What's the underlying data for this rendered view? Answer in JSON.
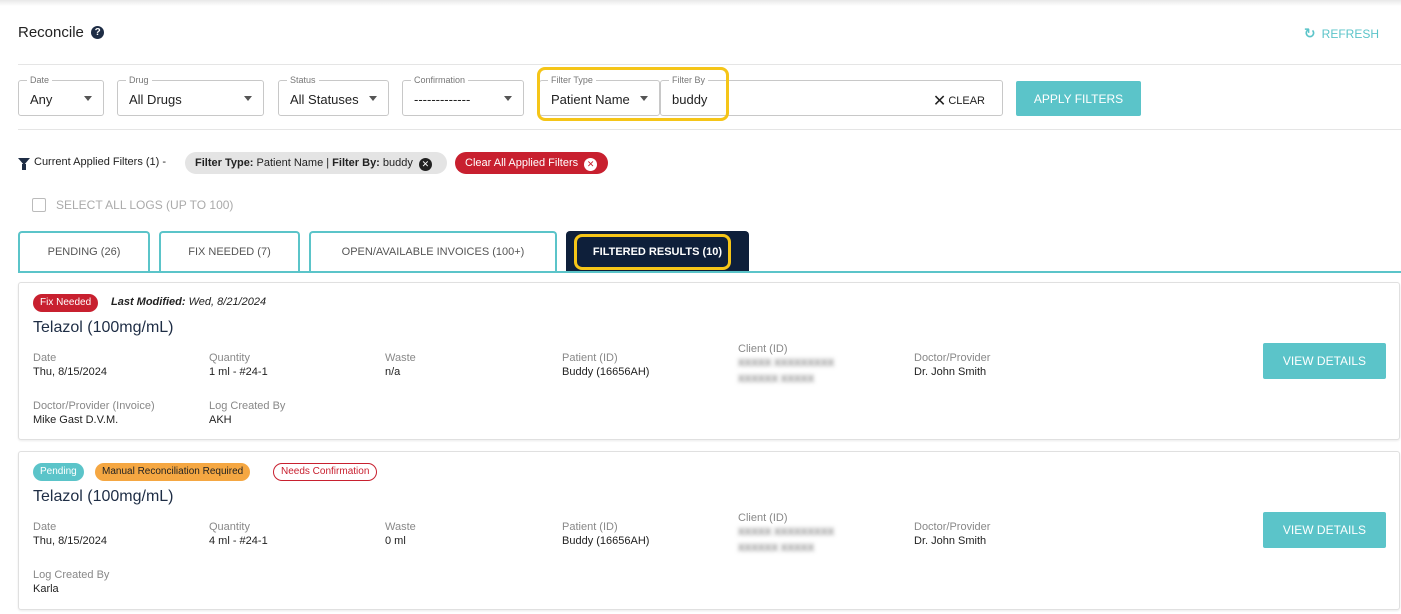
{
  "header": {
    "title": "Reconcile",
    "help_glyph": "?",
    "refresh_label": "REFRESH"
  },
  "filters": {
    "date": {
      "label": "Date",
      "value": "Any"
    },
    "drug": {
      "label": "Drug",
      "value": "All Drugs"
    },
    "status": {
      "label": "Status",
      "value": "All Statuses"
    },
    "confirmation": {
      "label": "Confirmation",
      "value": "-------------"
    },
    "filter_type": {
      "label": "Filter Type",
      "value": "Patient Name"
    },
    "filter_by": {
      "label": "Filter By",
      "value": "buddy"
    },
    "clear_label": "CLEAR",
    "apply_label": "APPLY FILTERS"
  },
  "applied_filters": {
    "label": "Current Applied Filters (1) -",
    "chip_type_key": "Filter Type:",
    "chip_type_value": "Patient Name |",
    "chip_by_key": "Filter By:",
    "chip_by_value": "buddy",
    "clear_all_label": "Clear All Applied Filters"
  },
  "select_all": {
    "label": "SELECT ALL LOGS (UP TO 100)",
    "checked": false
  },
  "tabs": [
    {
      "label": "PENDING (26)",
      "active": false
    },
    {
      "label": "FIX NEEDED (7)",
      "active": false
    },
    {
      "label": "OPEN/AVAILABLE INVOICES (100+)",
      "active": false
    },
    {
      "label": "FILTERED RESULTS (10)",
      "active": true
    }
  ],
  "colors": {
    "accent": "#5bc4c9",
    "navy": "#0e1f3a",
    "red": "#c8202f",
    "orange": "#f5a742",
    "highlight": "#f5c518"
  },
  "cards": [
    {
      "badges": [
        "Fix Needed"
      ],
      "last_modified_label": "Last Modified:",
      "last_modified_value": "Wed, 8/21/2024",
      "drug": "Telazol (100mg/mL)",
      "date_label": "Date",
      "date": "Thu, 8/15/2024",
      "quantity_label": "Quantity",
      "quantity": "1 ml - #24-1",
      "waste_label": "Waste",
      "waste": "n/a",
      "patient_label": "Patient (ID)",
      "patient": "Buddy (16656AH)",
      "client_label": "Client (ID)",
      "doctor_label": "Doctor/Provider",
      "doctor": "Dr. John Smith",
      "extra1_label": "Doctor/Provider (Invoice)",
      "extra1": "Mike Gast D.V.M.",
      "extra2_label": "Log Created By",
      "extra2": "AKH",
      "view_label": "VIEW DETAILS"
    },
    {
      "badges": [
        "Pending",
        "Manual Reconciliation Required",
        "Needs Confirmation"
      ],
      "drug": "Telazol (100mg/mL)",
      "date_label": "Date",
      "date": "Thu, 8/15/2024",
      "quantity_label": "Quantity",
      "quantity": "4 ml - #24-1",
      "waste_label": "Waste",
      "waste": "0 ml",
      "patient_label": "Patient (ID)",
      "patient": "Buddy (16656AH)",
      "client_label": "Client (ID)",
      "doctor_label": "Doctor/Provider",
      "doctor": "Dr. John Smith",
      "extra1_label": "Log Created By",
      "extra1": "Karla",
      "view_label": "VIEW DETAILS"
    }
  ]
}
